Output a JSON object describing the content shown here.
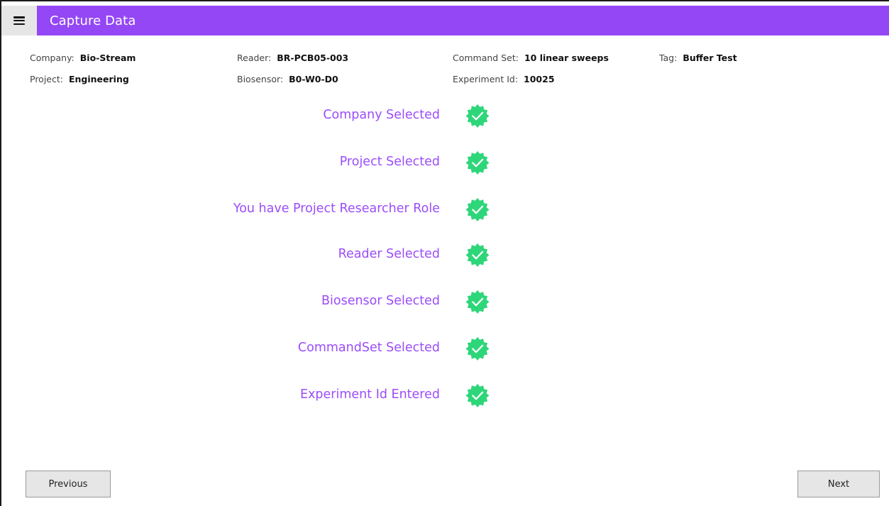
{
  "header": {
    "title": "Capture Data",
    "menu_icon": "hamburger-menu-icon",
    "accent_color": "#9447f5"
  },
  "info": {
    "company": {
      "label": "Company:",
      "value": "Bio-Stream"
    },
    "project": {
      "label": "Project:",
      "value": "Engineering"
    },
    "reader": {
      "label": "Reader:",
      "value": "BR-PCB05-003"
    },
    "biosensor": {
      "label": "Biosensor:",
      "value": "B0-W0-D0"
    },
    "command_set": {
      "label": "Command Set:",
      "value": "10 linear sweeps"
    },
    "experiment_id": {
      "label": "Experiment Id:",
      "value": "10025"
    },
    "tag": {
      "label": "Tag:",
      "value": "Buffer Test"
    }
  },
  "checklist": {
    "items": [
      {
        "label": "Company Selected",
        "status": "complete",
        "icon": "check-badge-icon"
      },
      {
        "label": "Project Selected",
        "status": "complete",
        "icon": "check-badge-icon"
      },
      {
        "label": "You have Project Researcher Role",
        "status": "complete",
        "icon": "check-badge-icon"
      },
      {
        "label": "Reader Selected",
        "status": "complete",
        "icon": "check-badge-icon"
      },
      {
        "label": "Biosensor Selected",
        "status": "complete",
        "icon": "check-badge-icon"
      },
      {
        "label": "CommandSet Selected",
        "status": "complete",
        "icon": "check-badge-icon"
      },
      {
        "label": "Experiment Id Entered",
        "status": "complete",
        "icon": "check-badge-icon"
      }
    ],
    "label_color": "#9b4dfa",
    "badge_color": "#2ed67a"
  },
  "footer": {
    "previous_label": "Previous",
    "next_label": "Next"
  }
}
